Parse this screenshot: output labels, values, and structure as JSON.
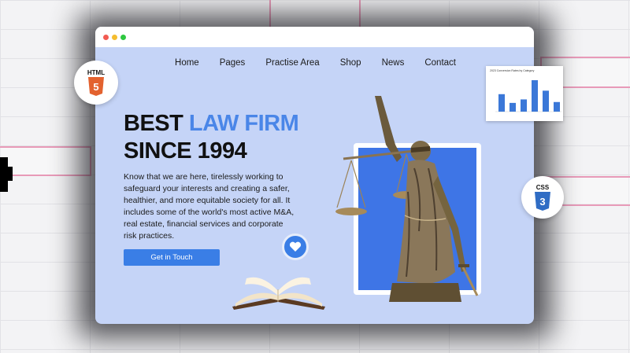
{
  "window": {
    "traffic_lights": [
      "#f25b52",
      "#f5bd2f",
      "#2ec840"
    ]
  },
  "nav": {
    "items": [
      {
        "label": "Home"
      },
      {
        "label": "Pages"
      },
      {
        "label": "Practise Area"
      },
      {
        "label": "Shop"
      },
      {
        "label": "News"
      },
      {
        "label": "Contact"
      }
    ]
  },
  "hero": {
    "title_line1_prefix": "BEST ",
    "title_line1_accent": "LAW FIRM",
    "title_line2": "SINCE 1994",
    "description": "Know that we are here, tirelessly working to safeguard your interests and creating a safer, healthier, and more equitable society for all. It includes some of the world's most active M&A, real estate, financial services and corporate risk practices.",
    "cta_label": "Get in Touch"
  },
  "badges": {
    "html_label": "HTML",
    "html_glyph": "5",
    "css_label": "CSS",
    "css_glyph": "3"
  },
  "mini_chart": {
    "title": "2023 Conversion Rates by Category",
    "bar_color": "#3b78d8",
    "values": [
      40,
      20,
      28,
      72,
      48,
      22
    ]
  },
  "colors": {
    "accent": "#4a86e8",
    "button": "#3a7ee6",
    "window_bg": "#c5d4f7",
    "photo_bg": "#3e75e6"
  }
}
